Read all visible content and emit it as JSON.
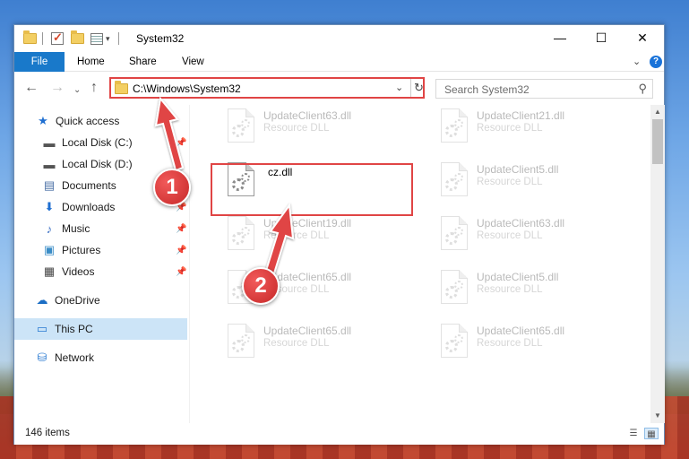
{
  "window": {
    "title": "System32",
    "controls": {
      "minimize": "—",
      "maximize": "☐",
      "close": "✕"
    }
  },
  "ribbon": {
    "tabs": [
      {
        "label": "File"
      },
      {
        "label": "Home"
      },
      {
        "label": "Share"
      },
      {
        "label": "View"
      }
    ],
    "expand": "⌄",
    "help": "?"
  },
  "nav": {
    "back": "←",
    "forward": "→",
    "recent": "⌄",
    "up": "↑",
    "address": "C:\\Windows\\System32",
    "dropdown": "⌄",
    "refresh": "↻"
  },
  "search": {
    "placeholder": "Search System32",
    "icon": "⚲"
  },
  "sidebar": {
    "items": [
      {
        "label": "Quick access",
        "icon": "star-icon",
        "glyph": "★",
        "color": "#1f6fd1"
      },
      {
        "label": "Local Disk (C:)",
        "icon": "drive-icon",
        "glyph": "▬",
        "color": "#555"
      },
      {
        "label": "Local Disk (D:)",
        "icon": "drive-icon",
        "glyph": "▬",
        "color": "#555"
      },
      {
        "label": "Documents",
        "icon": "documents-icon",
        "glyph": "▤",
        "color": "#4a6fa5"
      },
      {
        "label": "Downloads",
        "icon": "download-icon",
        "glyph": "⬇",
        "color": "#1f6fd1"
      },
      {
        "label": "Music",
        "icon": "music-icon",
        "glyph": "♪",
        "color": "#3a6fc4"
      },
      {
        "label": "Pictures",
        "icon": "pictures-icon",
        "glyph": "▣",
        "color": "#3b8dc7"
      },
      {
        "label": "Videos",
        "icon": "videos-icon",
        "glyph": "▦",
        "color": "#444"
      },
      {
        "label": "OneDrive",
        "icon": "cloud-icon",
        "glyph": "☁",
        "color": "#1a6dc4"
      },
      {
        "label": "This PC",
        "icon": "computer-icon",
        "glyph": "▭",
        "color": "#2a7ad1"
      },
      {
        "label": "Network",
        "icon": "network-icon",
        "glyph": "⛁",
        "color": "#2a7ad1"
      }
    ],
    "pin": "📌"
  },
  "files": [
    {
      "name": "UpdateClient63.dll",
      "type": "Resource DLL"
    },
    {
      "name": "UpdateClient21.dll",
      "type": "Resource DLL"
    },
    {
      "name": "cz.dll",
      "type": ""
    },
    {
      "name": "UpdateClient5.dll",
      "type": "Resource DLL"
    },
    {
      "name": "UpdateClient19.dll",
      "type": "Resource DLL"
    },
    {
      "name": "UpdateClient63.dll",
      "type": "Resource DLL"
    },
    {
      "name": "UpdateClient65.dll",
      "type": "Resource DLL"
    },
    {
      "name": "UpdateClient5.dll",
      "type": "Resource DLL"
    },
    {
      "name": "UpdateClient65.dll",
      "type": "Resource DLL"
    },
    {
      "name": "UpdateClient65.dll",
      "type": "Resource DLL"
    }
  ],
  "status": {
    "count": "146 items"
  },
  "annotations": {
    "step1": "1",
    "step2": "2",
    "color": "#e04545"
  }
}
